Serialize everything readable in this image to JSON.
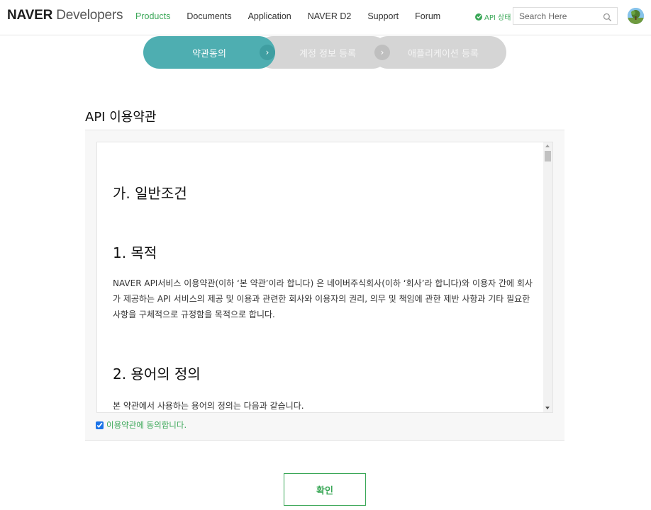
{
  "header": {
    "logo_bold": "NAVER",
    "logo_light": "Developers",
    "nav": [
      {
        "label": "Products"
      },
      {
        "label": "Documents"
      },
      {
        "label": "Application"
      },
      {
        "label": "NAVER D2"
      },
      {
        "label": "Support"
      },
      {
        "label": "Forum"
      }
    ],
    "api_status": "API 상태",
    "search_placeholder": "Search Here"
  },
  "steps": [
    {
      "label": "약관동의",
      "state": "active"
    },
    {
      "label": "계정 정보 등록",
      "state": "inactive"
    },
    {
      "label": "애플리케이션 등록",
      "state": "inactive"
    }
  ],
  "page_title": "API 이용약관",
  "terms": {
    "heading_general": "가. 일반조건",
    "heading_purpose": "1. 목적",
    "purpose_text": "NAVER API서비스 이용약관(이하 ‘본 약관’이라 합니다) 은 네이버주식회사(이하 ‘회사’라 합니다)와 이용자 간에 회사가 제공하는 API 서비스의 제공 및 이용과 관련한 회사와 이용자의 권리, 의무 및 책임에 관한 제반 사항과 기타 필요한 사항을 구체적으로 규정함을 목적으로 합니다.",
    "heading_definitions": "2. 용어의 정의",
    "definitions_text": "본 약관에서 사용하는 용어의 정의는 다음과 같습니다."
  },
  "agree_label": "이용약관에 동의합니다.",
  "agree_checked": true,
  "confirm_label": "확인",
  "colors": {
    "accent_green": "#3aa757",
    "step_active": "#4eaeb1",
    "step_inactive": "#d5d5d5"
  }
}
